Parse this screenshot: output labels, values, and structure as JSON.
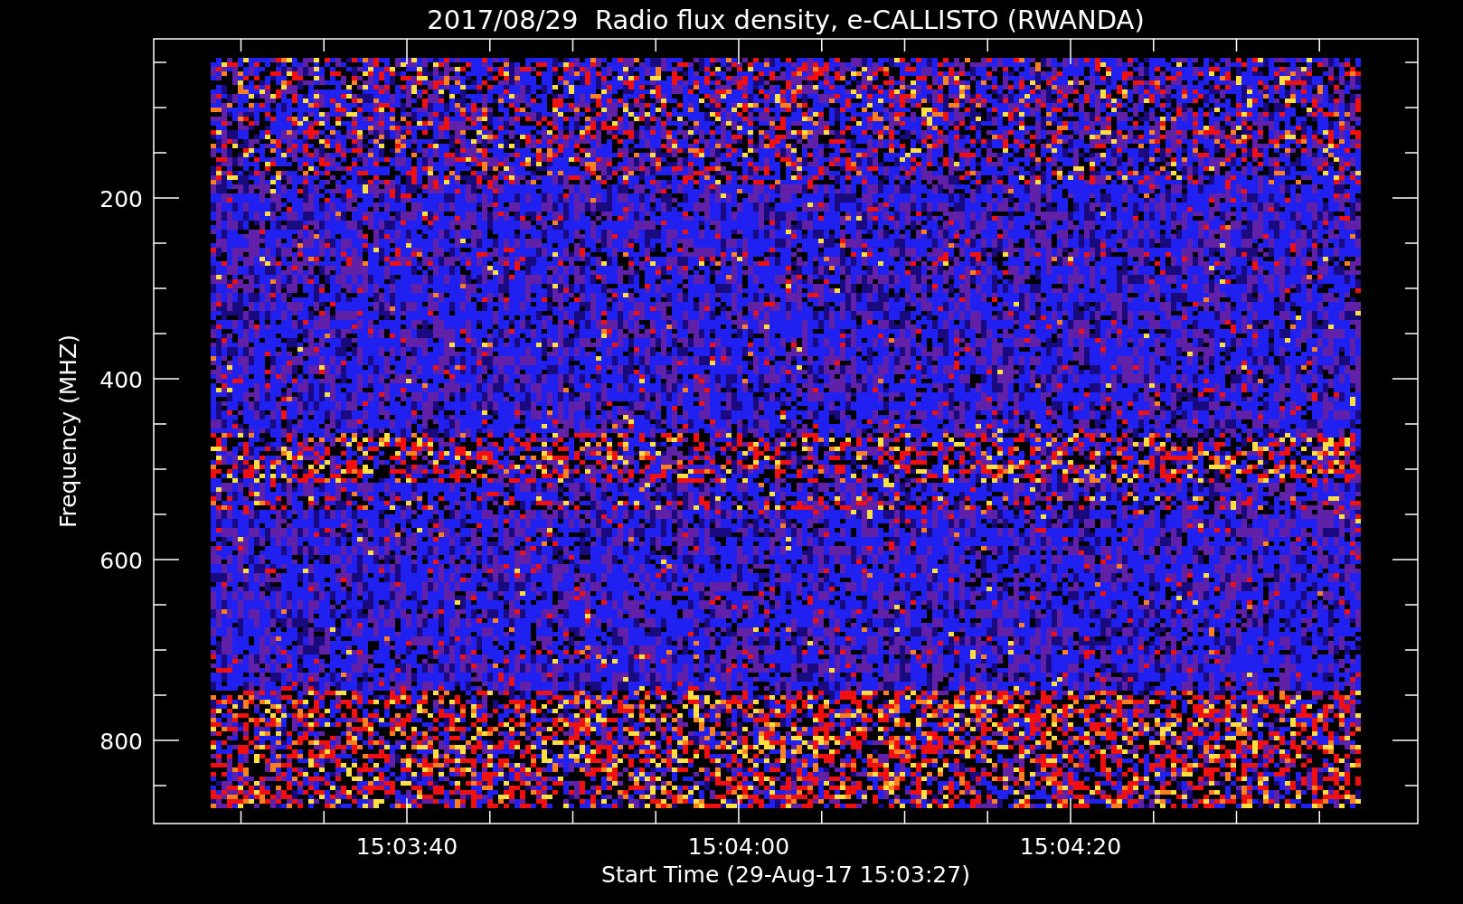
{
  "title": "2017/08/29  Radio flux density, e-CALLISTO (RWANDA)",
  "y_axis": {
    "label": "Frequency (MHZ)",
    "ticks": [
      "200",
      "400",
      "600",
      "800"
    ]
  },
  "x_axis": {
    "label": "Start Time (29-Aug-17 15:03:27)",
    "ticks": [
      "15:03:40",
      "15:04:00",
      "15:04:20"
    ]
  }
}
